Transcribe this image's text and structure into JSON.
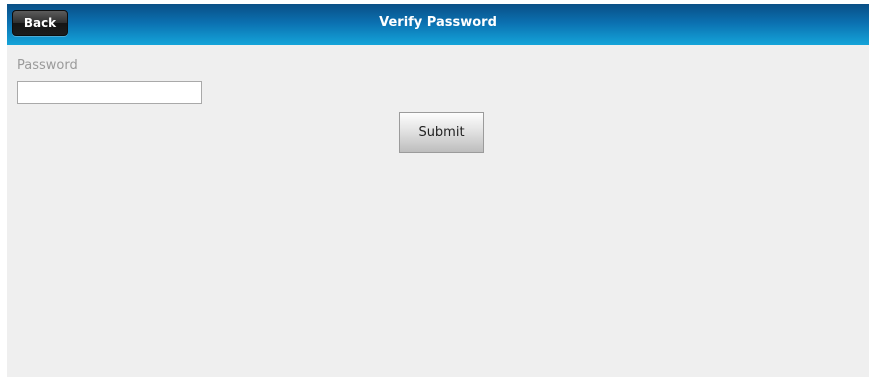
{
  "header": {
    "back_label": "Back",
    "title": "Verify Password",
    "gradient_top": "#0a4f86",
    "gradient_bottom": "#14a4d9"
  },
  "form": {
    "password_label": "Password",
    "password_value": "",
    "submit_label": "Submit"
  }
}
